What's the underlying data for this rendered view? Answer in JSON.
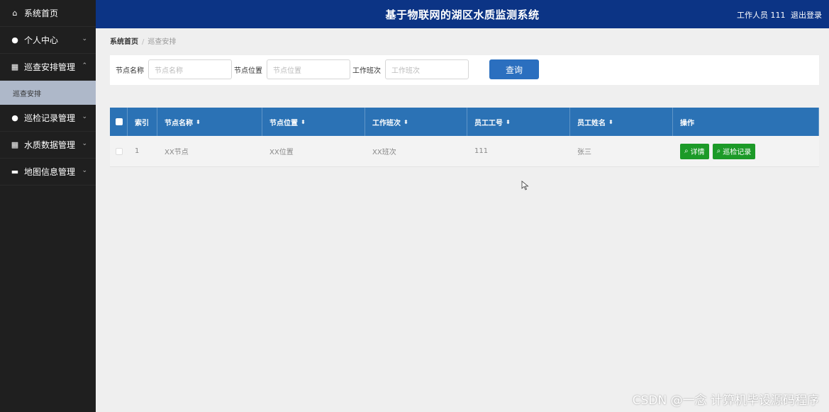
{
  "sidebar": {
    "items": [
      {
        "label": "系统首页",
        "icon": "home-icon",
        "glyph": "⌂",
        "chevron": ""
      },
      {
        "label": "个人中心",
        "icon": "user-icon",
        "glyph": "●",
        "chevron": "⌄"
      },
      {
        "label": "巡查安排管理",
        "icon": "grid-icon",
        "glyph": "▦",
        "chevron": "⌃"
      },
      {
        "label": "巡检记录管理",
        "icon": "user-icon",
        "glyph": "●",
        "chevron": "⌄"
      },
      {
        "label": "水质数据管理",
        "icon": "grid-icon",
        "glyph": "▦",
        "chevron": "⌄"
      },
      {
        "label": "地图信息管理",
        "icon": "briefcase-icon",
        "glyph": "▬",
        "chevron": "⌄"
      }
    ],
    "sub_item": "巡查安排"
  },
  "header": {
    "title": "基于物联网的湖区水质监测系统",
    "user_label": "工作人员 111",
    "logout": "退出登录"
  },
  "breadcrumb": {
    "home": "系统首页",
    "separator": "/",
    "current": "巡查安排"
  },
  "search": {
    "fields": [
      {
        "label": "节点名称",
        "placeholder": "节点名称"
      },
      {
        "label": "节点位置",
        "placeholder": "节点位置"
      },
      {
        "label": "工作班次",
        "placeholder": "工作班次"
      }
    ],
    "button": "查询"
  },
  "table": {
    "headers": [
      "索引",
      "节点名称",
      "节点位置",
      "工作班次",
      "员工工号",
      "员工姓名",
      "操作"
    ],
    "sort_glyph": "⬍",
    "rows": [
      {
        "index": "1",
        "name": "XX节点",
        "location": "XX位置",
        "shift": "XX班次",
        "emp_no": "111",
        "emp_name": "张三"
      }
    ],
    "actions": [
      "详情",
      "巡检记录"
    ]
  },
  "watermark": "CSDN @一念 计算机毕设源码程序",
  "colors": {
    "header": "#0c3485",
    "sidebar": "#1f1f1f",
    "table_head": "#2b72b5",
    "action_button": "#1c9a28",
    "query_button": "#2b6fbf"
  }
}
